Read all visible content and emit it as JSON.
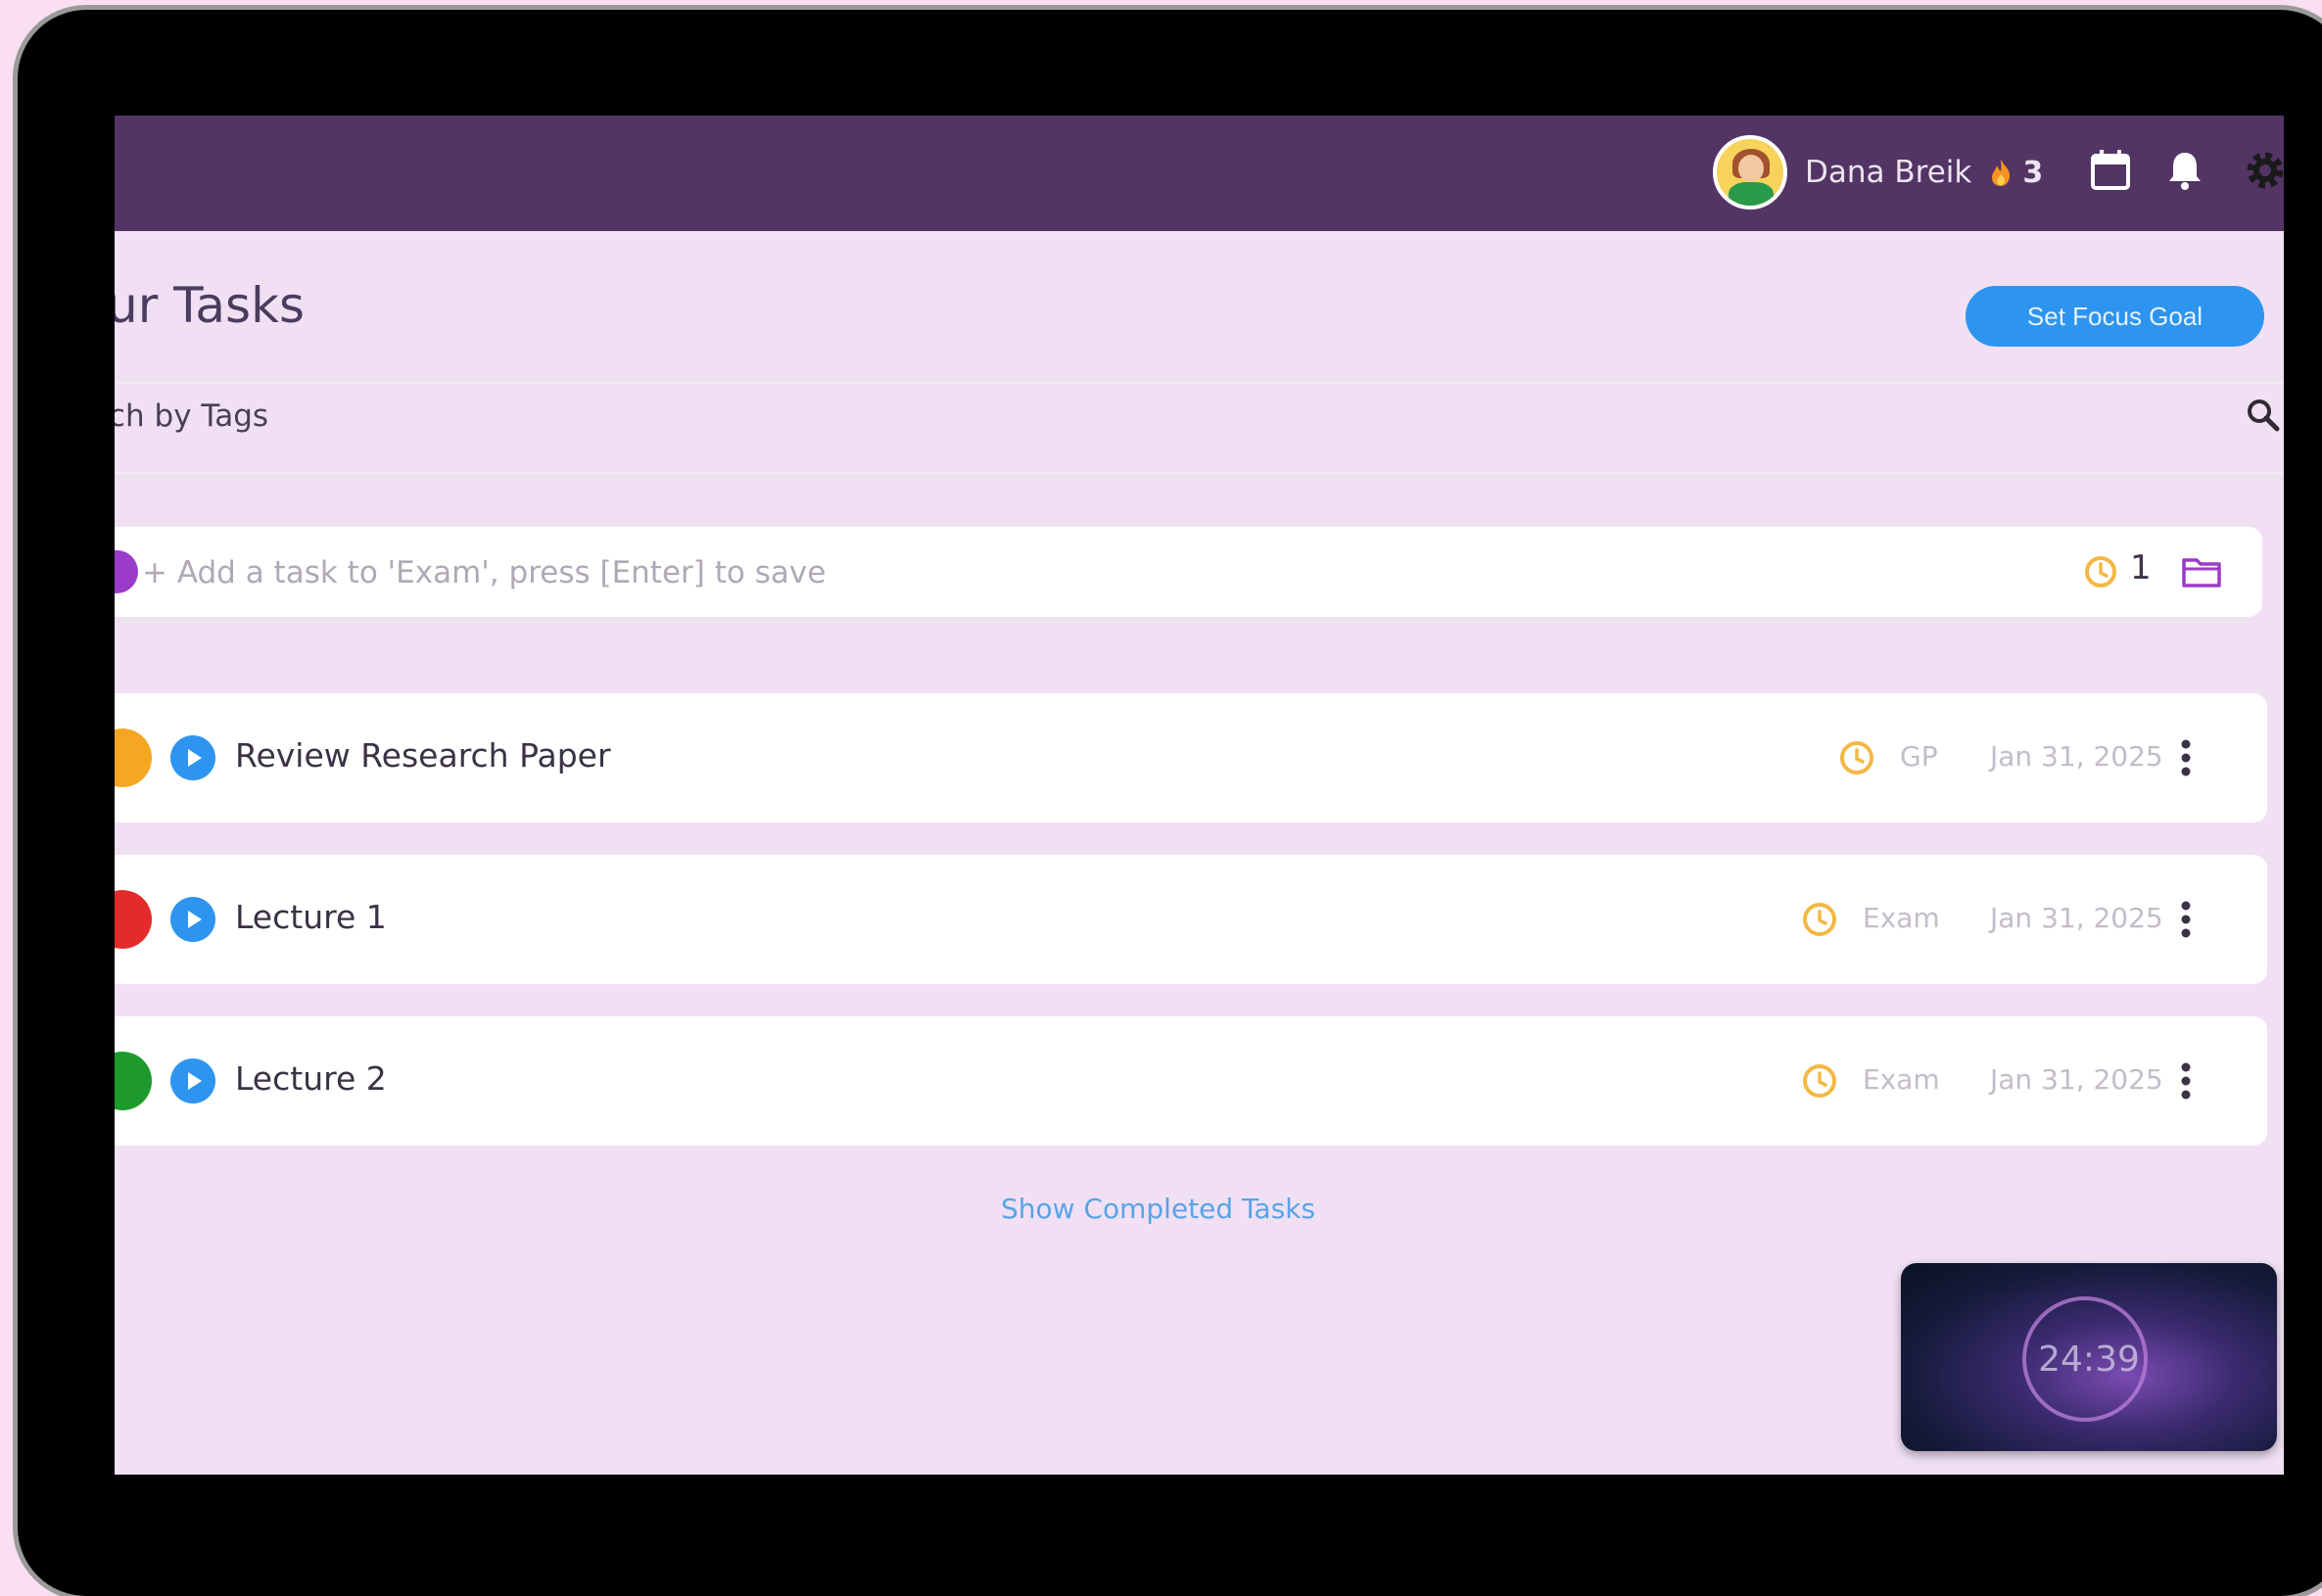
{
  "header": {
    "username": "Dana Breik",
    "streak": "3",
    "icons": [
      "calendar-icon",
      "bell-icon",
      "gear-icon"
    ]
  },
  "page": {
    "title": "ur Tasks",
    "focus_button": "Set Focus Goal"
  },
  "search": {
    "placeholder": "ch by Tags"
  },
  "add_task": {
    "placeholder": "+ Add a task to 'Exam', press [Enter] to save",
    "count": "1"
  },
  "tasks": [
    {
      "title": "Review Research Paper",
      "tag": "GP",
      "date": "Jan 31, 2025",
      "priority_color": "#f5a623"
    },
    {
      "title": "Lecture 1",
      "tag": "Exam",
      "date": "Jan 31, 2025",
      "priority_color": "#e32b2b"
    },
    {
      "title": "Lecture 2",
      "tag": "Exam",
      "date": "Jan 31, 2025",
      "priority_color": "#1e9a2c"
    }
  ],
  "show_completed": "Show Completed Tasks",
  "timer": {
    "time": "24:39"
  },
  "colors": {
    "topbar": "#523565",
    "background": "#f1e0f4",
    "accent_blue": "#2d95f0",
    "clock_orange": "#f3b844"
  }
}
